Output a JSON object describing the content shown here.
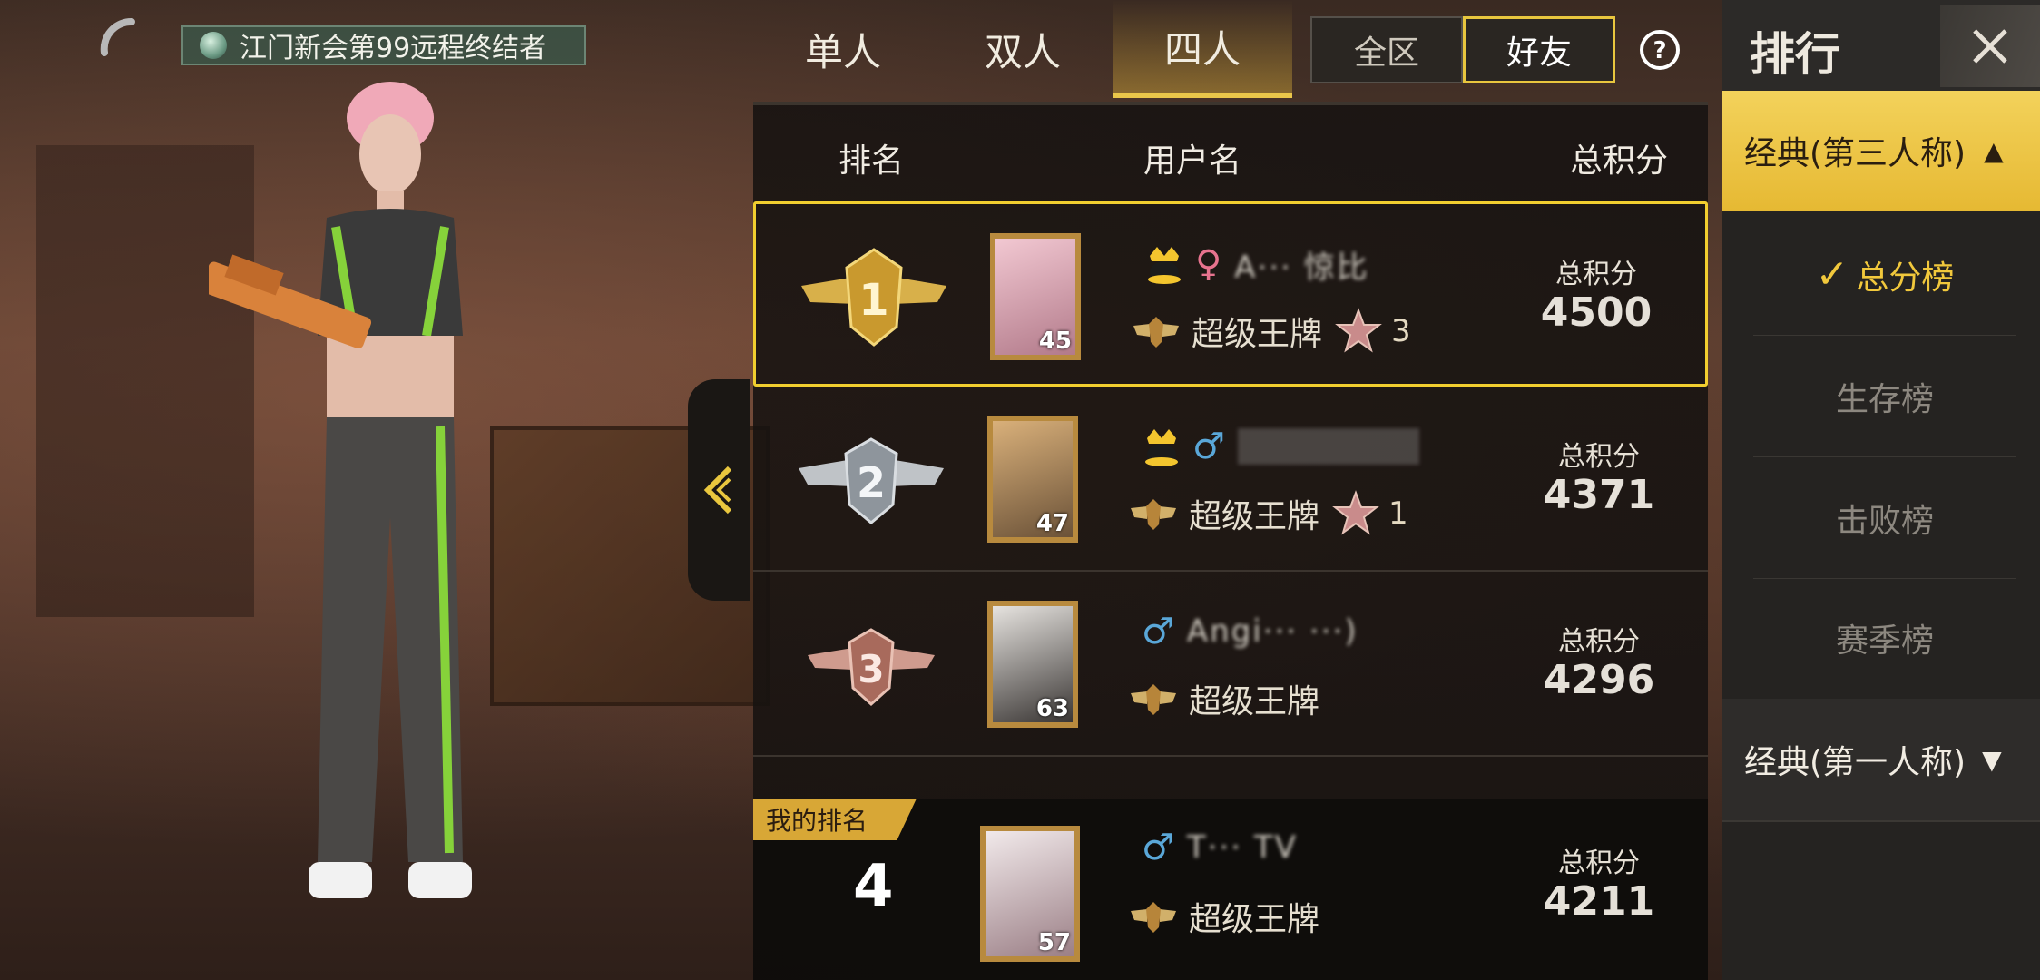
{
  "location_banner": {
    "text": "江门新会第99远程终结者"
  },
  "mode_tabs": [
    {
      "label": "单人",
      "active": false
    },
    {
      "label": "双人",
      "active": false
    },
    {
      "label": "四人",
      "active": true
    }
  ],
  "scope": {
    "all_label": "全区",
    "friends_label": "好友",
    "active": "friends"
  },
  "columns": {
    "rank": "排名",
    "username": "用户名",
    "score": "总积分"
  },
  "rows": [
    {
      "rank": "1",
      "level": "45",
      "gender": "♀",
      "name": "A··· 惊比",
      "tier": "超级王牌",
      "stars": "3",
      "score_label": "总积分",
      "score": "4500"
    },
    {
      "rank": "2",
      "level": "47",
      "gender": "♂",
      "name": "",
      "tier": "超级王牌",
      "stars": "1",
      "score_label": "总积分",
      "score": "4371"
    },
    {
      "rank": "3",
      "level": "63",
      "gender": "♂",
      "name": "Angi··· ···)",
      "tier": "超级王牌",
      "stars": "",
      "score_label": "总积分",
      "score": "4296"
    }
  ],
  "my_rank": {
    "tag": "我的排名",
    "rank": "4",
    "level": "57",
    "gender": "♂",
    "name": "T··· TV",
    "tier": "超级王牌",
    "score_label": "总积分",
    "score": "4211"
  },
  "right_panel": {
    "title": "排行",
    "open_category": "经典(第三人称)",
    "sub_items": [
      {
        "label": "总分榜",
        "active": true
      },
      {
        "label": "生存榜",
        "active": false
      },
      {
        "label": "击败榜",
        "active": false
      },
      {
        "label": "赛季榜",
        "active": false
      }
    ],
    "closed_category": "经典(第一人称)"
  },
  "colors": {
    "accent": "#f1ce2f",
    "female": "#e7738e",
    "male": "#5aa7d8"
  }
}
